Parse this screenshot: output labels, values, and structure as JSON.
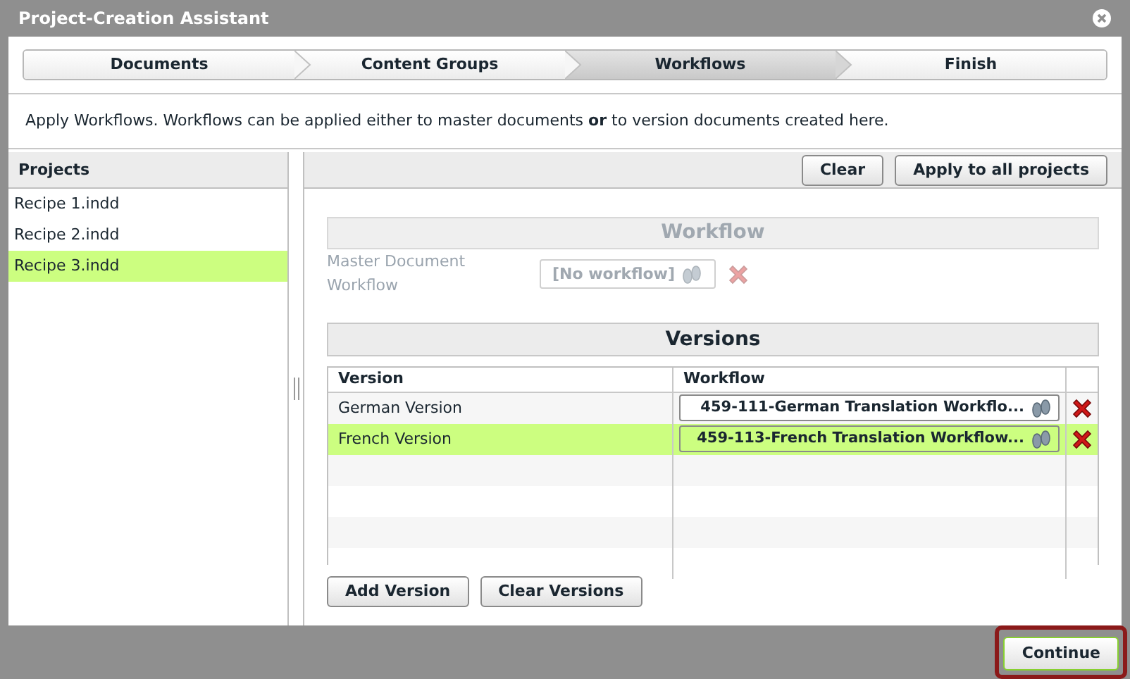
{
  "window": {
    "title": "Project-Creation Assistant"
  },
  "steps": [
    {
      "label": "Documents",
      "selected": false
    },
    {
      "label": "Content Groups",
      "selected": false
    },
    {
      "label": "Workflows",
      "selected": true
    },
    {
      "label": "Finish",
      "selected": false
    }
  ],
  "description": "Apply Workflows. Workflows can be applied either to master documents **or** to version documents created here.",
  "projects": {
    "title": "Projects",
    "items": [
      {
        "label": "Recipe 1.indd",
        "selected": false
      },
      {
        "label": "Recipe 2.indd",
        "selected": false
      },
      {
        "label": "Recipe 3.indd",
        "selected": true
      }
    ]
  },
  "toolbar": {
    "buttons": [
      "Clear",
      "Apply to all projects"
    ]
  },
  "workflow": {
    "title": "Workflow",
    "disabled": true,
    "label": "Master Document Workflow",
    "value": "[No workflow]"
  },
  "versions": {
    "title": "Versions",
    "columns": [
      "Version",
      "Workflow"
    ],
    "rows": [
      {
        "version": "German Version",
        "workflow": "459-111-German Translation Workflo...",
        "selected": false
      },
      {
        "version": "French Version",
        "workflow": "459-113-French Translation Workflow...",
        "selected": true
      }
    ],
    "buttons": [
      "Add Version",
      "Clear Versions"
    ]
  },
  "footer": {
    "button": "Continue"
  }
}
